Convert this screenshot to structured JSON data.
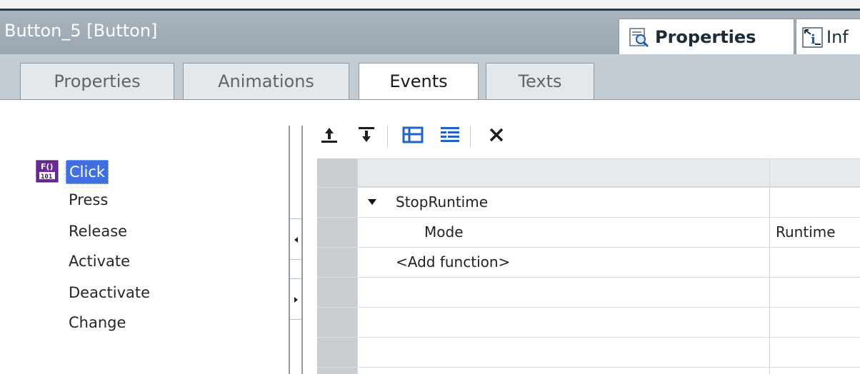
{
  "window": {
    "title": "Button_5 [Button]",
    "inspector_tabs": [
      {
        "label": "Properties",
        "icon": "magnifier-icon"
      },
      {
        "label": "Inf",
        "icon": "info-icon"
      }
    ]
  },
  "tabs": [
    {
      "label": "Properties"
    },
    {
      "label": "Animations"
    },
    {
      "label": "Events",
      "active": true
    },
    {
      "label": "Texts"
    }
  ],
  "events": {
    "selected": "Click",
    "items": [
      "Press",
      "Release",
      "Activate",
      "Deactivate",
      "Change"
    ]
  },
  "toolbar": {
    "icons": [
      "move-up-icon",
      "move-down-icon",
      "expand-icon",
      "collapse-icon",
      "delete-icon"
    ]
  },
  "functions": {
    "rows": [
      {
        "name": "StopRuntime",
        "value": "",
        "expanded": true
      },
      {
        "name": "Mode",
        "value": "Runtime"
      },
      {
        "name": "<Add function>",
        "value": ""
      }
    ]
  },
  "colors": {
    "title_bar": "#a3aeb8",
    "tab_bar": "#c3ccd3",
    "selection": "#3f6fe0",
    "grid_header": "#c8cdd1"
  }
}
